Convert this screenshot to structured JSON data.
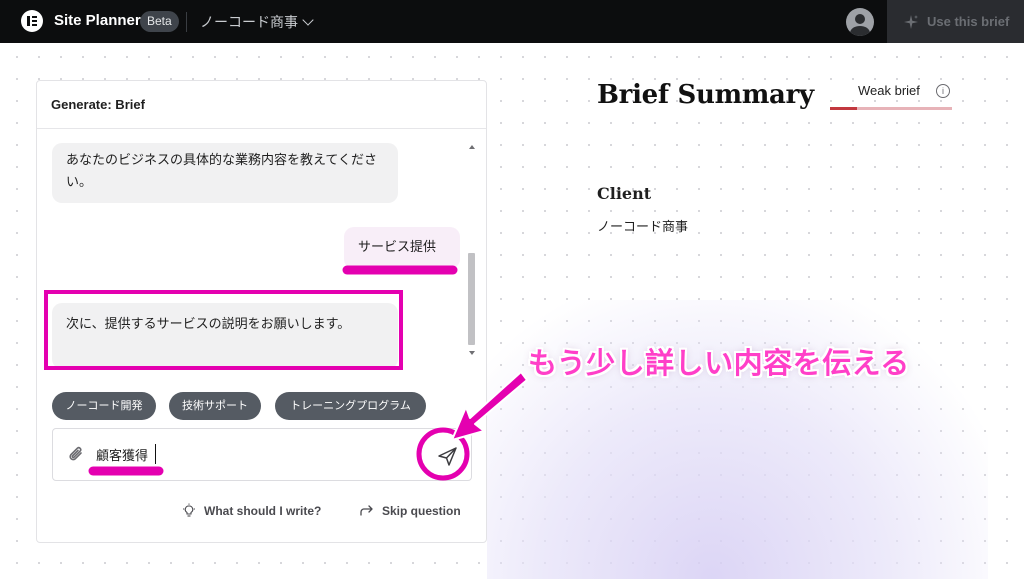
{
  "header": {
    "app_title": "Site Planner",
    "beta_badge": "Beta",
    "site_name": "ノーコード商事",
    "use_brief_label": "Use this brief"
  },
  "panel": {
    "title": "Generate: Brief",
    "messages": [
      {
        "role": "ai",
        "text": "あなたのビジネスの具体的な業務内容を教えてください。"
      },
      {
        "role": "user",
        "text": "サービス提供"
      },
      {
        "role": "ai",
        "text": "次に、提供するサービスの説明をお願いします。"
      }
    ],
    "suggestions": [
      "ノーコード開発",
      "技術サポート",
      "トレーニングプログラム"
    ],
    "input_value": "顧客獲得",
    "what_to_write": "What should I write?",
    "skip_question": "Skip question"
  },
  "summary": {
    "title": "Brief Summary",
    "strength_label": "Weak brief",
    "strength_level_percent": 22,
    "client_label": "Client",
    "client_value": "ノーコード商事"
  },
  "annotation": {
    "callout": "もう少し詳しい内容を伝える",
    "color": "#ff3fc8"
  },
  "colors": {
    "topbar": "#0c0d0e",
    "chip": "#555b63",
    "weak_indicator": "#c2383f"
  }
}
